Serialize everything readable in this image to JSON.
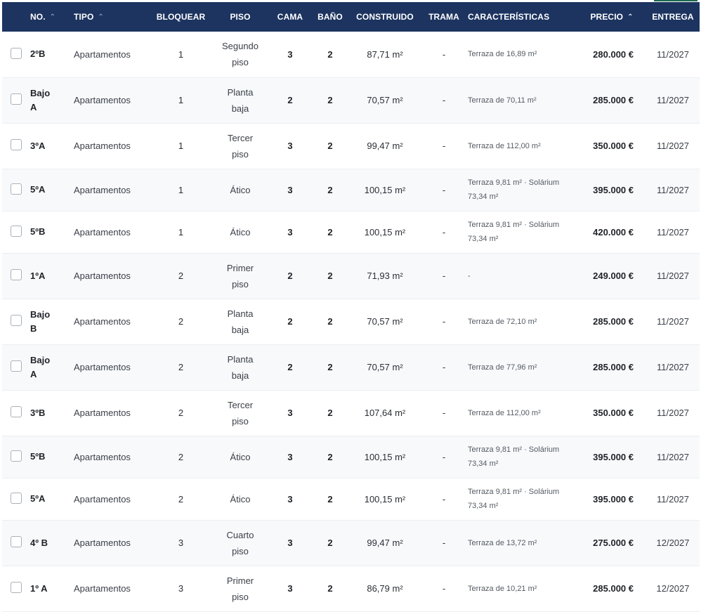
{
  "table": {
    "headers": [
      {
        "label": "No.",
        "sort": "up"
      },
      {
        "label": "Tipo",
        "sort": "up"
      },
      {
        "label": "Bloquear"
      },
      {
        "label": "Piso"
      },
      {
        "label": "Cama"
      },
      {
        "label": "Baño"
      },
      {
        "label": "Construido"
      },
      {
        "label": "Trama"
      },
      {
        "label": "Características"
      },
      {
        "label": "Precio",
        "sort": "up"
      },
      {
        "label": "Entrega"
      }
    ],
    "rows": [
      {
        "no": [
          "2ºB"
        ],
        "tipo": "Apartamentos",
        "bloquear": "1",
        "piso": [
          "Segundo",
          "piso"
        ],
        "cama": "3",
        "bano": "2",
        "construido": "87,71 m²",
        "trama": "-",
        "caracteristicas": [
          "Terraza de 16,89 m²"
        ],
        "precio": "280.000 €",
        "entrega": "11/2027",
        "height": 66
      },
      {
        "no": [
          "Bajo",
          "A"
        ],
        "tipo": "Apartamentos",
        "bloquear": "1",
        "piso": [
          "Planta",
          "baja"
        ],
        "cama": "2",
        "bano": "2",
        "construido": "70,57 m²",
        "trama": "-",
        "caracteristicas": [
          "Terraza de 70,11 m²"
        ],
        "precio": "285.000 €",
        "entrega": "11/2027",
        "height": 66
      },
      {
        "no": [
          "3ºA"
        ],
        "tipo": "Apartamentos",
        "bloquear": "1",
        "piso": [
          "Tercer",
          "piso"
        ],
        "cama": "3",
        "bano": "2",
        "construido": "99,47 m²",
        "trama": "-",
        "caracteristicas": [
          "Terraza de 112,00 m²"
        ],
        "precio": "350.000 €",
        "entrega": "11/2027",
        "height": 66
      },
      {
        "no": [
          "5ºA"
        ],
        "tipo": "Apartamentos",
        "bloquear": "1",
        "piso": [
          "Ático"
        ],
        "cama": "3",
        "bano": "2",
        "construido": "100,15 m²",
        "trama": "-",
        "caracteristicas": [
          "Terraza 9,81 m² · Solárium",
          "73,34 m²"
        ],
        "precio": "395.000 €",
        "entrega": "11/2027",
        "height": 61
      },
      {
        "no": [
          "5ºB"
        ],
        "tipo": "Apartamentos",
        "bloquear": "1",
        "piso": [
          "Ático"
        ],
        "cama": "3",
        "bano": "2",
        "construido": "100,15 m²",
        "trama": "-",
        "caracteristicas": [
          "Terraza 9,81 m² · Solárium",
          "73,34 m²"
        ],
        "precio": "420.000 €",
        "entrega": "11/2027",
        "height": 61
      },
      {
        "no": [
          "1ºA"
        ],
        "tipo": "Apartamentos",
        "bloquear": "2",
        "piso": [
          "Primer",
          "piso"
        ],
        "cama": "2",
        "bano": "2",
        "construido": "71,93 m²",
        "trama": "-",
        "caracteristicas": [
          "-"
        ],
        "precio": "249.000 €",
        "entrega": "11/2027",
        "height": 66
      },
      {
        "no": [
          "Bajo",
          "B"
        ],
        "tipo": "Apartamentos",
        "bloquear": "2",
        "piso": [
          "Planta",
          "baja"
        ],
        "cama": "2",
        "bano": "2",
        "construido": "70,57 m²",
        "trama": "-",
        "caracteristicas": [
          "Terraza de 72,10 m²"
        ],
        "precio": "285.000 €",
        "entrega": "11/2027",
        "height": 66
      },
      {
        "no": [
          "Bajo",
          "A"
        ],
        "tipo": "Apartamentos",
        "bloquear": "2",
        "piso": [
          "Planta",
          "baja"
        ],
        "cama": "2",
        "bano": "2",
        "construido": "70,57 m²",
        "trama": "-",
        "caracteristicas": [
          "Terraza de 77,96 m²"
        ],
        "precio": "285.000 €",
        "entrega": "11/2027",
        "height": 66
      },
      {
        "no": [
          "3ºB"
        ],
        "tipo": "Apartamentos",
        "bloquear": "2",
        "piso": [
          "Tercer",
          "piso"
        ],
        "cama": "3",
        "bano": "2",
        "construido": "107,64 m²",
        "trama": "-",
        "caracteristicas": [
          "Terraza de 112,00 m²"
        ],
        "precio": "350.000 €",
        "entrega": "11/2027",
        "height": 66
      },
      {
        "no": [
          "5ºB"
        ],
        "tipo": "Apartamentos",
        "bloquear": "2",
        "piso": [
          "Ático"
        ],
        "cama": "3",
        "bano": "2",
        "construido": "100,15 m²",
        "trama": "-",
        "caracteristicas": [
          "Terraza 9,81 m² · Solárium",
          "73,34 m²"
        ],
        "precio": "395.000 €",
        "entrega": "11/2027",
        "height": 61
      },
      {
        "no": [
          "5ºA"
        ],
        "tipo": "Apartamentos",
        "bloquear": "2",
        "piso": [
          "Ático"
        ],
        "cama": "3",
        "bano": "2",
        "construido": "100,15 m²",
        "trama": "-",
        "caracteristicas": [
          "Terraza 9,81 m² · Solárium",
          "73,34 m²"
        ],
        "precio": "395.000 €",
        "entrega": "11/2027",
        "height": 61
      },
      {
        "no": [
          "4º B"
        ],
        "tipo": "Apartamentos",
        "bloquear": "3",
        "piso": [
          "Cuarto",
          "piso"
        ],
        "cama": "3",
        "bano": "2",
        "construido": "99,47 m²",
        "trama": "-",
        "caracteristicas": [
          "Terraza de 13,72 m²"
        ],
        "precio": "275.000 €",
        "entrega": "12/2027",
        "height": 66
      },
      {
        "no": [
          "1º A"
        ],
        "tipo": "Apartamentos",
        "bloquear": "3",
        "piso": [
          "Primer",
          "piso"
        ],
        "cama": "3",
        "bano": "2",
        "construido": "86,79 m²",
        "trama": "-",
        "caracteristicas": [
          "Terraza de 10,21 m²"
        ],
        "precio": "285.000 €",
        "entrega": "12/2027",
        "height": 66
      }
    ]
  }
}
